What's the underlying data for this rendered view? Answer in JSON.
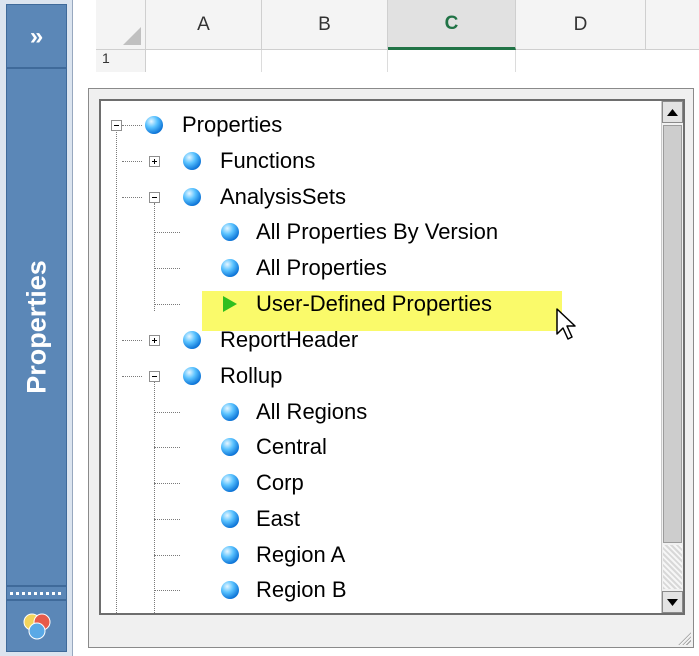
{
  "side_panel": {
    "expand_glyph": "»",
    "title": "Properties"
  },
  "sheet": {
    "columns": [
      "A",
      "B",
      "C",
      "D"
    ],
    "active_column": "C",
    "row_number": "1"
  },
  "tree": {
    "items": [
      {
        "label": "Properties",
        "icon": "blue-ball-icon",
        "expander": "minus"
      },
      {
        "label": "Functions",
        "icon": "blue-ball-icon",
        "expander": "plus"
      },
      {
        "label": "AnalysisSets",
        "icon": "blue-ball-icon",
        "expander": "minus"
      },
      {
        "label": "All Properties By Version",
        "icon": "blue-ball-icon"
      },
      {
        "label": "All Properties",
        "icon": "blue-ball-icon"
      },
      {
        "label": "User-Defined Properties",
        "icon": "green-arrow-icon",
        "selected": true
      },
      {
        "label": "ReportHeader",
        "icon": "blue-ball-icon",
        "expander": "plus"
      },
      {
        "label": "Rollup",
        "icon": "blue-ball-icon",
        "expander": "minus"
      },
      {
        "label": "All Regions",
        "icon": "blue-ball-icon"
      },
      {
        "label": "Central",
        "icon": "blue-ball-icon"
      },
      {
        "label": "Corp",
        "icon": "blue-ball-icon"
      },
      {
        "label": "East",
        "icon": "blue-ball-icon"
      },
      {
        "label": "Region A",
        "icon": "blue-ball-icon"
      },
      {
        "label": "Region B",
        "icon": "blue-ball-icon"
      }
    ]
  },
  "colors": {
    "side_panel_blue": "#5b87b7",
    "highlight_yellow": "#fafa6a",
    "excel_green": "#217346",
    "arrow_green": "#2fbf1f"
  }
}
